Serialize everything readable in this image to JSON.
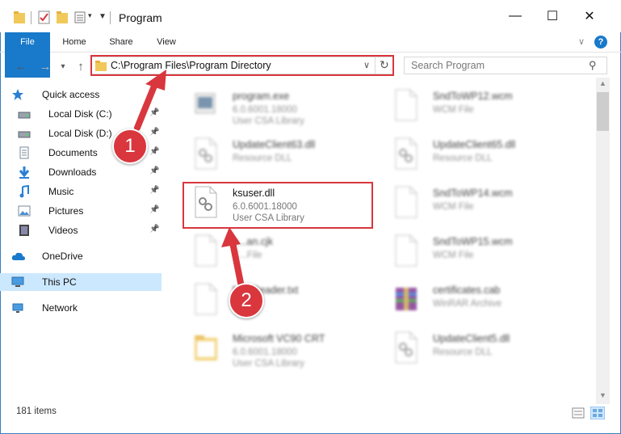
{
  "window": {
    "title": "Program",
    "minimize": "—",
    "maximize": "☐",
    "close": "✕"
  },
  "ribbon": {
    "tabs": [
      "File",
      "Home",
      "Share",
      "View"
    ],
    "expand": "∨",
    "help": "?"
  },
  "address": {
    "path": "C:\\Program Files\\Program Directory",
    "dropdown": "∨",
    "refresh": "↻",
    "search_placeholder": "Search Program"
  },
  "sidebar": {
    "items": [
      {
        "label": "Quick access",
        "icon": "star-icon",
        "pinned": false
      },
      {
        "label": "Local Disk (C:)",
        "icon": "drive-icon",
        "pinned": true
      },
      {
        "label": "Local Disk (D:)",
        "icon": "drive-icon",
        "pinned": true
      },
      {
        "label": "Documents",
        "icon": "documents-icon",
        "pinned": true
      },
      {
        "label": "Downloads",
        "icon": "download-icon",
        "pinned": true
      },
      {
        "label": "Music",
        "icon": "music-icon",
        "pinned": true
      },
      {
        "label": "Pictures",
        "icon": "pictures-icon",
        "pinned": true
      },
      {
        "label": "Videos",
        "icon": "videos-icon",
        "pinned": true
      },
      {
        "label": "OneDrive",
        "icon": "cloud-icon",
        "pinned": false
      },
      {
        "label": "This PC",
        "icon": "pc-icon",
        "pinned": false,
        "selected": true
      },
      {
        "label": "Network",
        "icon": "network-icon",
        "pinned": false
      }
    ]
  },
  "files": [
    {
      "name": "program.exe",
      "line1": "6.0.6001.18000",
      "line2": "User CSA Library",
      "icon": "exe-icon"
    },
    {
      "name": "SndToWP12.wcm",
      "line1": "WCM File",
      "line2": "",
      "icon": "file-icon"
    },
    {
      "name": "UpdateClient63.dll",
      "line1": "Resource DLL",
      "line2": "",
      "icon": "dll-icon"
    },
    {
      "name": "UpdateClient65.dll",
      "line1": "Resource DLL",
      "line2": "",
      "icon": "dll-icon"
    },
    {
      "name": "ksuser.dll",
      "line1": "6.0.6001.18000",
      "line2": "User CSA Library",
      "icon": "dll-icon"
    },
    {
      "name": "SndToWP14.wcm",
      "line1": "WCM File",
      "line2": "",
      "icon": "file-icon"
    },
    {
      "name": "p...an.cjk",
      "line1": "C...File",
      "line2": "",
      "icon": "file-icon"
    },
    {
      "name": "SndToWP15.wcm",
      "line1": "WCM File",
      "line2": "",
      "icon": "file-icon"
    },
    {
      "name": "h...eReader.txt",
      "line1": "",
      "line2": "",
      "icon": "file-icon"
    },
    {
      "name": "certificates.cab",
      "line1": "WinRAR Archive",
      "line2": "",
      "icon": "archive-icon"
    },
    {
      "name": "Microsoft VC90 CRT",
      "line1": "6.0.6001.18000",
      "line2": "User CSA Library",
      "icon": "folder-icon"
    },
    {
      "name": "UpdateClient5.dll",
      "line1": "Resource DLL",
      "line2": "",
      "icon": "dll-icon"
    }
  ],
  "status": {
    "count": "181 items"
  },
  "annotations": {
    "badge1": "1",
    "badge2": "2",
    "color": "#d9363e"
  }
}
